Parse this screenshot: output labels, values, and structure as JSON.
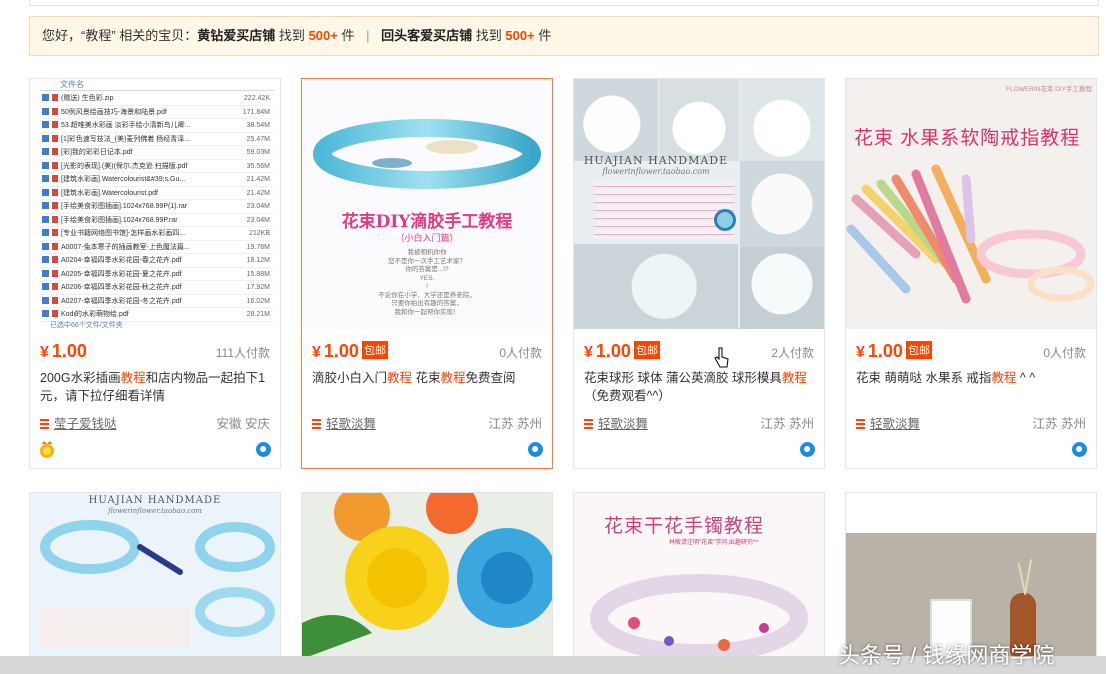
{
  "notice": {
    "prefix": "您好，“教程” 相关的宝贝：",
    "shop1": "黄钻爱买店铺",
    "found1": "找到",
    "count1": "500+",
    "unit1": "件",
    "sep": "|",
    "shop2": "回头客爱买店铺",
    "found2": "找到",
    "count2": "500+",
    "unit2": "件"
  },
  "items": [
    {
      "price": "1.00",
      "yen": "¥",
      "baoyou": "",
      "paid": "111人付款",
      "title_parts": [
        "200G水彩插画",
        "教程",
        "和店内物品一起拍下1元，请下拉仔细看详情"
      ],
      "shop": "莹子爱钱哒",
      "location": "安徽 安庆",
      "file_list": [
        "(赠送) 生色彩.zip",
        "50例风景绘画技巧-海景和陆景.pdf",
        "53.超唯美水彩画 淡彩手绘小清新鸟儿卿...",
        "[1]彩色速写技法_(美)麦列佛着 杨经青泽...",
        "[彩]我的彩彩日记本.pdf",
        "[光影的表现].(美)(保尔.杰克逊.扫描版.pdf",
        "[建筑水彩画].Watercolourist&#39;s.Gu...",
        "[建筑水彩画].Watercolourist.pdf",
        "[手绘美食彩图插画].1024x768.99P(1).rar",
        "[手绘美食彩图插画].1024x768.99P.rar",
        "[专业书籍网络图书馆]-怎样画水彩画四...",
        "A0007-兔本寒子的插画教室-上色魔法篇...",
        "A0204-幸福四季水彩花园-春之花卉.pdf",
        "A0205-幸福四季水彩花园-夏之花卉.pdf",
        "A0206-幸福四季水彩花园-秋之花卉.pdf",
        "A0207-幸福四季水彩花园-冬之花卉.pdf",
        "Kodi的水彩萌物绘.pdf"
      ],
      "file_sizes": [
        "222.42K",
        "171.84M",
        "38.54M",
        "25.47M",
        "59.03M",
        "35.56M",
        "21.42M",
        "21.42M",
        "23.04M",
        "23.04M",
        "212KB",
        "19.76M",
        "18.12M",
        "15.88M",
        "17.92M",
        "16.02M",
        "28.21M"
      ],
      "file_header": "文件名",
      "file_footer": "已选中66个文件/文件夹"
    },
    {
      "price": "1.00",
      "yen": "¥",
      "baoyou": "包邮",
      "paid": "0人付款",
      "title_parts": [
        "滴胶小白入门",
        "教程",
        " 花束",
        "教程",
        "免费查阅"
      ],
      "shop": "轻歌淡舞",
      "location": "江苏 苏州",
      "thumb_title": "花束DIY滴胶手工教程",
      "thumb_sub": "（小白入门篇）",
      "thumb_lines": [
        "我被相机你你",
        "您不是你一次手工艺术家？",
        "你的答案是...!?",
        "YES.",
        "!",
        "不论你在小学、大学还是养老院，",
        "只要你拍出有趣的答案，",
        "我和你一起帮你实现！"
      ]
    },
    {
      "price": "1.00",
      "yen": "¥",
      "baoyou": "包邮",
      "paid": "2人付款",
      "title_parts": [
        "花束球形 球体 蒲公英滴胶 球形模具",
        "教程",
        "（免费观看^^）"
      ],
      "shop": "轻歌淡舞",
      "location": "江苏 苏州",
      "thumb_brand": "HUAJIAN HANDMADE",
      "thumb_brand_sub": "flowerinflower.taobao.com"
    },
    {
      "price": "1.00",
      "yen": "¥",
      "baoyou": "包邮",
      "paid": "0人付款",
      "title_parts": [
        "花束 萌萌哒 水果系 戒指",
        "教程",
        " ^ ^"
      ],
      "shop": "轻歌淡舞",
      "location": "江苏 苏州",
      "thumb_title": "花束 水果系软陶戒指教程",
      "thumb_brand": "FLOWERIN花束 DIY手工教程"
    }
  ],
  "row2": {
    "brand": "HUAJIAN HANDMADE",
    "brand_sub": "flowerinflower.taobao.com",
    "bracelet_title": "花束干花手镯教程",
    "bracelet_sub": "林敏请注明\"花束\"学问,出趣研究^^"
  },
  "watermark": "头条号 / 钱缘网商学院",
  "colors": {
    "accent": "#ff4400",
    "border": "#e5e5e5",
    "notice_bg": "#fff8e8"
  },
  "icons": [
    "gold-crown-icon",
    "wangwang-chat-icon",
    "shop-list-icon",
    "mouse-pointer-icon"
  ]
}
